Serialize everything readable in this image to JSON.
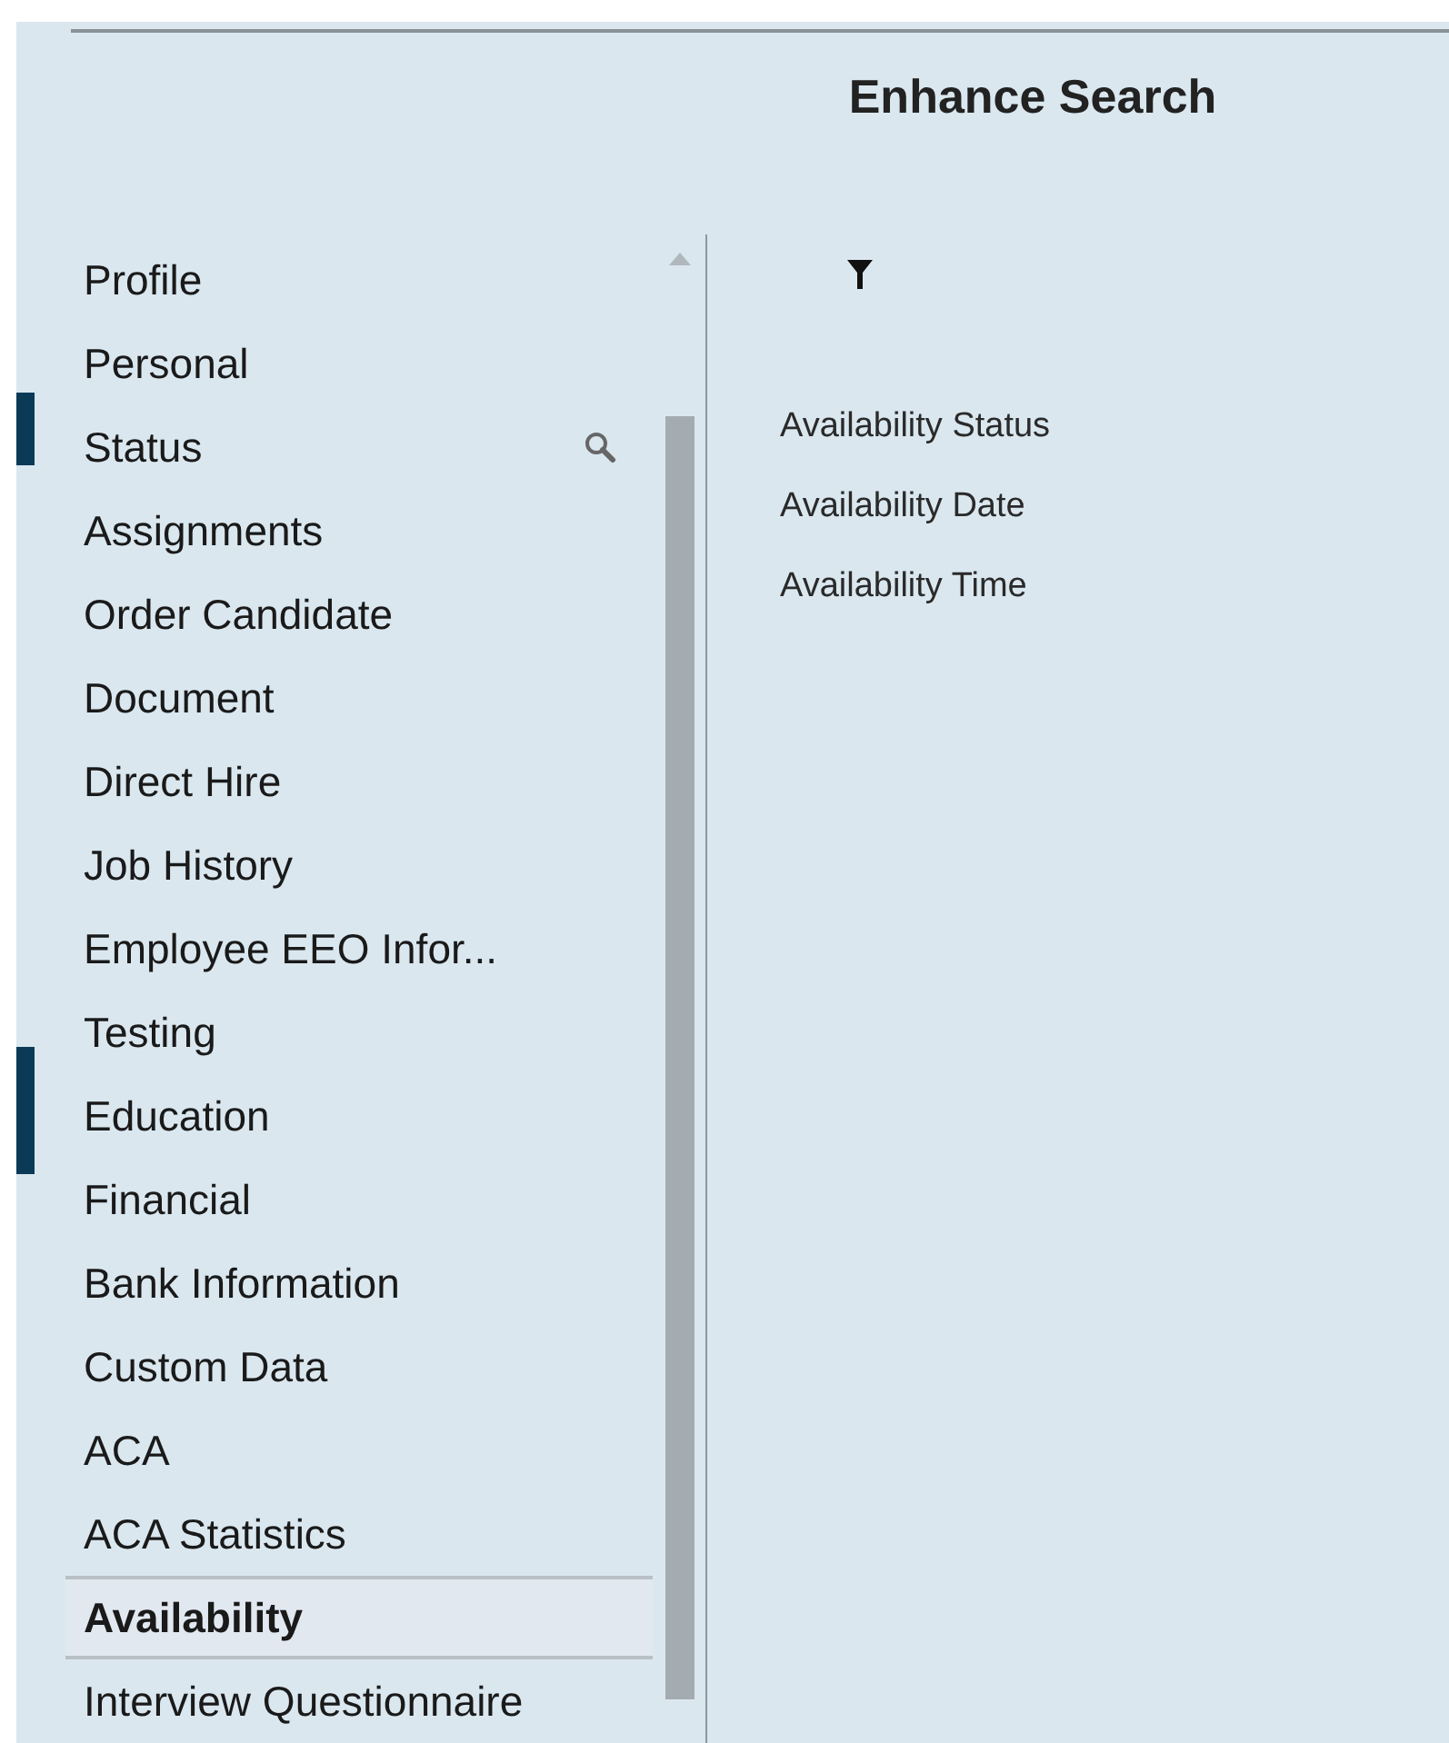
{
  "title": "Enhance Search",
  "sidebar": {
    "items": [
      {
        "label": "Profile",
        "selected": false,
        "search_icon": false
      },
      {
        "label": "Personal",
        "selected": false,
        "search_icon": false
      },
      {
        "label": "Status",
        "selected": false,
        "search_icon": true
      },
      {
        "label": "Assignments",
        "selected": false,
        "search_icon": false
      },
      {
        "label": "Order Candidate",
        "selected": false,
        "search_icon": false
      },
      {
        "label": "Document",
        "selected": false,
        "search_icon": false
      },
      {
        "label": "Direct Hire",
        "selected": false,
        "search_icon": false
      },
      {
        "label": "Job History",
        "selected": false,
        "search_icon": false
      },
      {
        "label": "Employee EEO Infor...",
        "selected": false,
        "search_icon": false
      },
      {
        "label": "Testing",
        "selected": false,
        "search_icon": false
      },
      {
        "label": "Education",
        "selected": false,
        "search_icon": false
      },
      {
        "label": "Financial",
        "selected": false,
        "search_icon": false
      },
      {
        "label": "Bank Information",
        "selected": false,
        "search_icon": false
      },
      {
        "label": "Custom Data",
        "selected": false,
        "search_icon": false
      },
      {
        "label": "ACA",
        "selected": false,
        "search_icon": false
      },
      {
        "label": "ACA Statistics",
        "selected": false,
        "search_icon": false
      },
      {
        "label": "Availability",
        "selected": true,
        "search_icon": false
      },
      {
        "label": "Interview Questionnaire",
        "selected": false,
        "search_icon": false
      }
    ]
  },
  "fields": [
    "Availability Status",
    "Availability Date",
    "Availability Time"
  ]
}
